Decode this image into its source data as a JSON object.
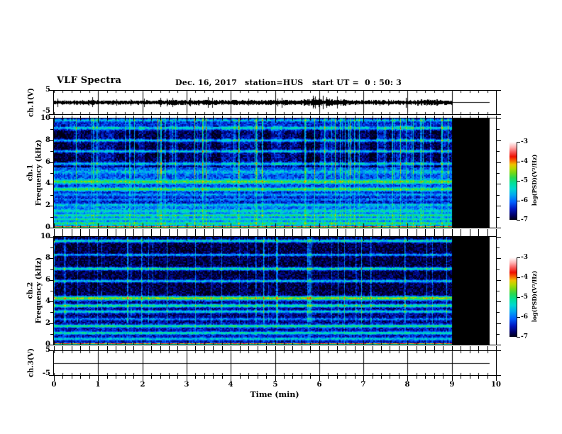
{
  "header": {
    "title": "VLF Spectra",
    "date": "Dec. 16, 2017",
    "station": "station=HUS",
    "start_ut": "start UT =  0 : 50: 3"
  },
  "x_axis": {
    "label": "Time (min)",
    "min": 0,
    "max": 10,
    "tick_labels": [
      "0",
      "1",
      "2",
      "3",
      "4",
      "5",
      "6",
      "7",
      "8",
      "9",
      "10"
    ],
    "minor_step_min": 0.2
  },
  "freq_axis": {
    "label": "Frequency (kHz)",
    "min": 0,
    "max": 10,
    "tick_values": [
      0,
      1,
      2,
      3,
      4,
      5,
      6,
      7,
      8,
      9,
      10
    ],
    "labeled_values": [
      10,
      8,
      6,
      4,
      2,
      0
    ],
    "labels": {
      "10": "10",
      "8": "8",
      "6": "6",
      "4": "4",
      "2": "2",
      "0": "0"
    }
  },
  "panels": {
    "ch1_wave": {
      "label": "ch.1(V)",
      "y_top_label": "5",
      "y_bottom_label": "-5"
    },
    "spec1": {
      "label_channel": "ch.1",
      "label_axis": "Frequency (kHz)"
    },
    "spec2": {
      "label_channel": "ch.2",
      "label_axis": "Frequency (kHz)"
    },
    "ch3_wave": {
      "label": "ch.3(V)",
      "y_top_label": "5",
      "y_bottom_label": "-5"
    }
  },
  "colorbar": {
    "unit_label": "log(PSD)(V²/Hz)",
    "tick_labels": [
      "-3",
      "-4",
      "-5",
      "-6",
      "-7"
    ],
    "max": -3,
    "min": -7,
    "stops": [
      [
        0.0,
        "#000014"
      ],
      [
        0.06,
        "#000068"
      ],
      [
        0.14,
        "#0018c0"
      ],
      [
        0.23,
        "#0060ff"
      ],
      [
        0.32,
        "#00a8f0"
      ],
      [
        0.4,
        "#00d8d0"
      ],
      [
        0.47,
        "#00e098"
      ],
      [
        0.54,
        "#28d850"
      ],
      [
        0.6,
        "#70d818"
      ],
      [
        0.66,
        "#b8d800"
      ],
      [
        0.71,
        "#f0c000"
      ],
      [
        0.76,
        "#f86000"
      ],
      [
        0.81,
        "#ee1000"
      ],
      [
        0.87,
        "#f85858"
      ],
      [
        0.93,
        "#ffb0b0"
      ],
      [
        1.0,
        "#ffffff"
      ]
    ]
  },
  "chart_data": [
    {
      "type": "line",
      "name": "ch1-waveform",
      "ylabel": "ch.1(V)",
      "y_range": [
        -5,
        5
      ],
      "x_range_min": [
        0,
        10
      ],
      "signal": "dense broadband noise centered on 0 V, amplitude about ±1 V",
      "data_end_min": 9.0,
      "flat_trace_end_min": 9.85
    },
    {
      "type": "heatmap",
      "name": "ch1-spectrogram",
      "ylabel": "ch.1 Frequency (kHz)",
      "x_range_min": [
        0,
        10
      ],
      "y_range_khz": [
        0,
        10
      ],
      "z_label": "log(PSD)(V²/Hz)",
      "z_range": [
        -7,
        -3
      ],
      "data_end_min": 9.0,
      "nodata_black_until_min": 9.85,
      "base_levels": [
        [
          0.0,
          2.2,
          -6.0
        ],
        [
          2.2,
          3.3,
          -6.4
        ],
        [
          3.3,
          4.4,
          -6.25
        ],
        [
          4.4,
          5.5,
          -6.15
        ],
        [
          5.5,
          9.4,
          -6.75
        ],
        [
          9.4,
          10.0,
          -6.35
        ]
      ],
      "bands": [
        [
          0.05,
          -3.8,
          0.04
        ],
        [
          0.35,
          -4.95,
          0.1
        ],
        [
          0.75,
          -5.2,
          0.09
        ],
        [
          1.1,
          -5.0,
          0.08
        ],
        [
          1.5,
          -5.3,
          0.1
        ],
        [
          2.05,
          -5.5,
          0.08
        ],
        [
          2.55,
          -5.95,
          0.08
        ],
        [
          3.0,
          -5.8,
          0.1
        ],
        [
          3.5,
          -4.85,
          0.11
        ],
        [
          4.2,
          -4.7,
          0.13
        ],
        [
          5.1,
          -5.6,
          0.12
        ],
        [
          5.85,
          -5.45,
          0.1
        ],
        [
          7.0,
          -5.5,
          0.09
        ],
        [
          8.0,
          -5.5,
          0.09
        ],
        [
          9.15,
          -5.4,
          0.12
        ],
        [
          9.85,
          -5.5,
          0.07
        ]
      ],
      "vertical_streaks": {
        "fraction": 0.11,
        "max_boost": 1.6,
        "full_above_khz": 4.5,
        "low_factor": 0.45
      },
      "blocky_texture_khz": [
        5.5,
        9.35
      ],
      "seed": 101
    },
    {
      "type": "heatmap",
      "name": "ch2-spectrogram",
      "ylabel": "ch.2 Frequency (kHz)",
      "x_range_min": [
        0,
        10
      ],
      "y_range_khz": [
        0,
        10
      ],
      "z_label": "log(PSD)(V²/Hz)",
      "z_range": [
        -7,
        -3
      ],
      "data_end_min": 9.0,
      "nodata_black_until_min": 9.85,
      "base_levels": [
        [
          0.0,
          2.0,
          -6.5
        ],
        [
          2.0,
          4.5,
          -6.65
        ],
        [
          4.5,
          10.0,
          -6.88
        ]
      ],
      "bands": [
        [
          0.05,
          -3.8,
          0.04
        ],
        [
          0.5,
          -5.5,
          0.09
        ],
        [
          1.05,
          -5.15,
          0.09
        ],
        [
          1.7,
          -5.0,
          0.09
        ],
        [
          2.35,
          -5.9,
          0.08
        ],
        [
          3.05,
          -5.4,
          0.09
        ],
        [
          3.6,
          -5.0,
          0.1
        ],
        [
          4.3,
          -4.5,
          0.13
        ],
        [
          5.9,
          -5.5,
          0.09
        ],
        [
          7.05,
          -5.15,
          0.1
        ],
        [
          8.35,
          -5.65,
          0.08
        ],
        [
          9.65,
          -5.3,
          0.1
        ]
      ],
      "vertical_streaks": {
        "fraction": 0.06,
        "max_boost": 1.1,
        "full_above_khz": 2.0,
        "low_factor": 0.3
      },
      "blocky_texture_khz": null,
      "seed": 202
    },
    {
      "type": "line",
      "name": "ch3-waveform",
      "ylabel": "ch.3(V)",
      "y_range": [
        -5,
        5
      ],
      "x_range_min": [
        0,
        10
      ],
      "signal": "flat line at 0 V (no signal)",
      "data_end_min": 9.85,
      "flat_trace_end_min": 9.85
    }
  ]
}
